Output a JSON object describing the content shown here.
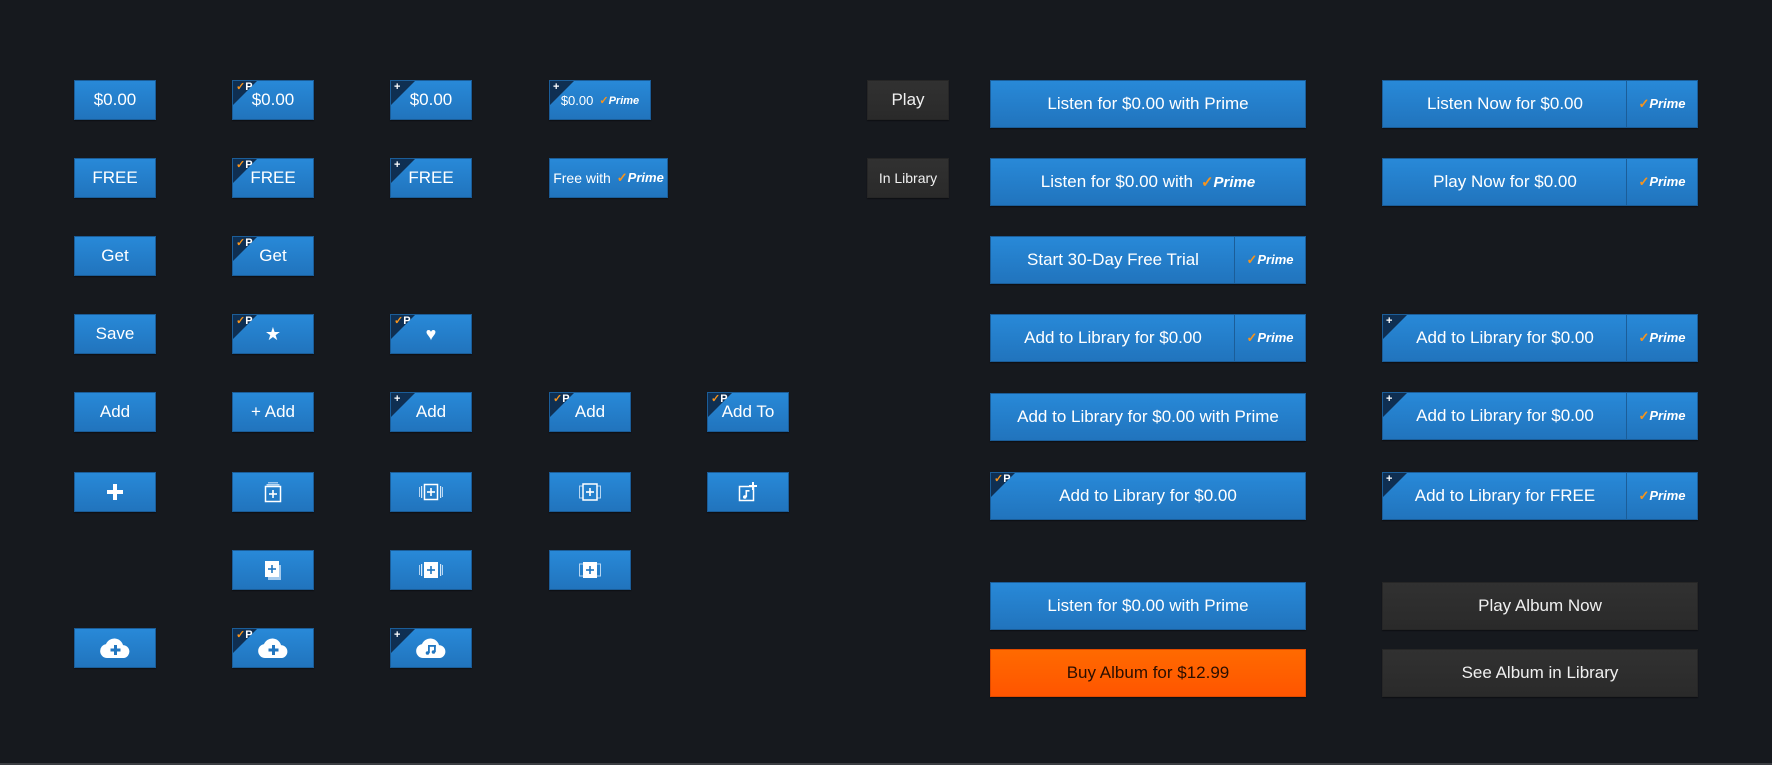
{
  "colors": {
    "background": "#16191e",
    "button_blue": "#2581cc",
    "button_dark": "#2e2e2e",
    "button_orange": "#ff5f00",
    "prime_check": "#f7941d",
    "corner_badge": "#0f2f52"
  },
  "badges": {
    "prime_glyph": "✓P",
    "add_glyph": "+"
  },
  "prime_logo": {
    "check": "✓",
    "text": "Prime"
  },
  "small_buttons": {
    "price_plain": "$0.00",
    "price_prime": "$0.00",
    "price_add": "$0.00",
    "price_add_prime": "$0.00",
    "free_plain": "FREE",
    "free_prime": "FREE",
    "free_add": "FREE",
    "free_with": "Free with",
    "get_plain": "Get",
    "get_prime": "Get",
    "save": "Save",
    "add_plain": "Add",
    "add_plus": "+ Add",
    "add_add": "Add",
    "add_prime": "Add",
    "add_to_prime": "Add To",
    "play": "Play",
    "in_library": "In Library"
  },
  "wide_buttons": {
    "listen_prime": "Listen for $0.00 with Prime",
    "listen_with_logo": "Listen for $0.00 with",
    "start_trial": "Start 30-Day Free Trial",
    "add_library_side": "Add to Library for $0.00",
    "add_library_with_prime": "Add to Library for $0.00 with Prime",
    "add_library_prime_badge": "Add to Library for $0.00",
    "listen_prime_2": "Listen for $0.00 with Prime",
    "buy_album": "Buy Album for $12.99",
    "listen_now": "Listen Now for $0.00",
    "play_now": "Play Now for $0.00",
    "add_library_add_1": "Add to Library for $0.00",
    "add_library_add_2": "Add to Library for $0.00",
    "add_library_free": "Add to Library for FREE",
    "play_album_now": "Play Album Now",
    "see_album_library": "See Album in Library"
  }
}
